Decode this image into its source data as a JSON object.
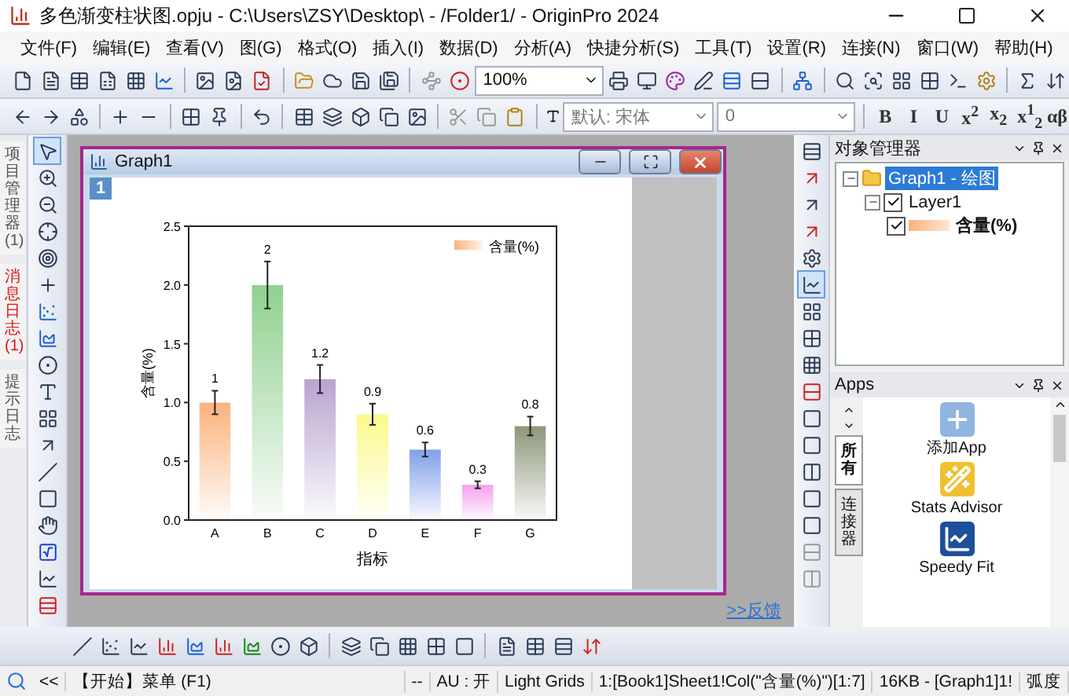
{
  "window": {
    "title": "多色渐变柱状图.opju - C:\\Users\\ZSY\\Desktop\\ - /Folder1/ - OriginPro 2024"
  },
  "menu": [
    "文件(F)",
    "编辑(E)",
    "查看(V)",
    "图(G)",
    "格式(O)",
    "插入(I)",
    "数据(D)",
    "分析(A)",
    "快捷分析(S)",
    "工具(T)",
    "设置(R)",
    "连接(N)",
    "窗口(W)",
    "帮助(H)"
  ],
  "toolbar": {
    "zoom": "100%",
    "font": "默认: 宋体",
    "font_size": "0",
    "format_buttons": [
      "B",
      "I",
      "U",
      "x$^{2}$",
      "x$_{2}$",
      "x$^{1}$$_{2}$",
      "αβ"
    ]
  },
  "side_tabs": [
    {
      "label": "项目管理器 (1)",
      "alert": false
    },
    {
      "label": "消息日志 (1)",
      "alert": true
    },
    {
      "label": "提示日志",
      "alert": false
    }
  ],
  "graph_window": {
    "title": "Graph1",
    "layer": "1",
    "bars": [
      {
        "color": "#fbb27c"
      },
      {
        "color": "#8fd08f"
      },
      {
        "color": "#b9a3cf"
      },
      {
        "color": "#fbf98c"
      },
      {
        "color": "#7f9fe8"
      },
      {
        "color": "#f59ff0"
      },
      {
        "color": "#8c967a"
      }
    ],
    "chart_data": {
      "type": "bar",
      "xlabel": "指标",
      "ylabel": "含量(%)",
      "categories": [
        "A",
        "B",
        "C",
        "D",
        "E",
        "F",
        "G"
      ],
      "series": [
        {
          "name": "含量(%)",
          "values": [
            1,
            2,
            1.2,
            0.9,
            0.6,
            0.3,
            0.8
          ]
        }
      ],
      "ylim": [
        0,
        2.5
      ],
      "yticks": [
        {
          "value": 0,
          "label": "0.0"
        },
        {
          "value": 0.5,
          "label": "0.5"
        },
        {
          "value": 1,
          "label": "1.0"
        },
        {
          "value": 1.5,
          "label": "1.5"
        },
        {
          "value": 2,
          "label": "2.0"
        },
        {
          "value": 2.5,
          "label": "2.5"
        }
      ],
      "data_labels": true
    }
  },
  "feedback_link": ">>反馈",
  "object_manager": {
    "title": "对象管理器",
    "tree": [
      {
        "label": "Graph1 - 绘图",
        "selected": true,
        "expanded": true,
        "children": [
          {
            "label": "Layer1",
            "checked": true,
            "expanded": true,
            "children": [
              {
                "label": "含量(%)",
                "checked": true
              }
            ]
          }
        ]
      }
    ]
  },
  "apps": {
    "title": "Apps",
    "tabs": [
      {
        "label": "所有",
        "selected": true
      },
      {
        "label": "连接器",
        "selected": false
      }
    ],
    "items": [
      {
        "label": "添加App",
        "kind": "add"
      },
      {
        "label": "Stats Advisor",
        "kind": "wizard"
      },
      {
        "label": "Speedy Fit",
        "kind": "fit"
      }
    ]
  },
  "status_bar": [
    "<<",
    "【开始】菜单 (F1)",
    "--",
    "AU : 开",
    "Light Grids",
    "1:[Book1]Sheet1!Col(\"含量(%)\")[1:7]",
    "16KB - [Graph1]1!",
    "弧度"
  ]
}
